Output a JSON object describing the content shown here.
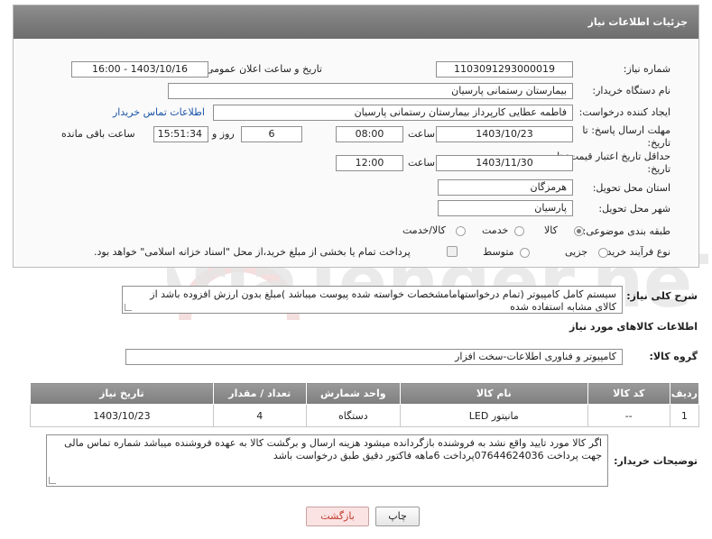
{
  "header": {
    "title": "جزئیات اطلاعات نیاز"
  },
  "form": {
    "need_number_label": "شماره نیاز:",
    "need_number": "1103091293000019",
    "announce_label": "تاریخ و ساعت اعلان عمومی:",
    "announce_value": "1403/10/16 - 16:00",
    "buyer_org_label": "نام دستگاه خریدار:",
    "buyer_org": "بیمارستان رستمانی پارسیان",
    "creator_label": "ایجاد کننده درخواست:",
    "creator": "فاطمه عطایی کارپرداز بیمارستان رستمانی پارسیان",
    "contact_link": "اطلاعات تماس خریدار",
    "deadline_label_1": "مهلت ارسال پاسخ: تا",
    "deadline_label_2": "تاریخ:",
    "deadline_date": "1403/10/23",
    "time_label": "ساعت",
    "deadline_time": "08:00",
    "days_value": "6",
    "days_label": "روز و",
    "remaining_time": "15:51:34",
    "remaining_label": "ساعت باقی مانده",
    "validity_label_1": "حداقل تاریخ اعتبار قیمت: تا",
    "validity_label_2": "تاریخ:",
    "validity_date": "1403/11/30",
    "validity_time_label": "ساعت",
    "validity_time": "12:00",
    "province_label": "استان محل تحویل:",
    "province": "هرمزگان",
    "city_label": "شهر محل تحویل:",
    "city": "پارسیان",
    "category_label": "طبقه بندی موضوعی:",
    "category_options": [
      "کالا",
      "خدمت",
      "کالا/خدمت"
    ],
    "process_label": "نوع فرآیند خرید :",
    "process_options": [
      "جزیی",
      "متوسط"
    ],
    "payment_note": "پرداخت تمام یا بخشی از مبلغ خرید،از محل \"اسناد خزانه اسلامی\" خواهد بود."
  },
  "description": {
    "label": "شرح کلی نیاز:",
    "text": "سیستم کامل کامپیوتر (تمام درخواستهامامشخصات خواسته شده پیوست میباشد )مبلغ بدون ارزش افزوده باشد از کالای مشابه استفاده شده"
  },
  "goods_section": {
    "title": "اطلاعات کالاهای مورد نیاز",
    "group_label": "گروه کالا:",
    "group_value": "کامپیوتر و فناوری اطلاعات-سخت افزار"
  },
  "table": {
    "headers": [
      "ردیف",
      "کد کالا",
      "نام کالا",
      "واحد شمارش",
      "تعداد / مقدار",
      "تاریخ نیاز"
    ],
    "rows": [
      [
        "1",
        "--",
        "مانیتور LED",
        "دستگاه",
        "4",
        "1403/10/23"
      ]
    ]
  },
  "buyer_notes": {
    "label": "توضیحات خریدار:",
    "text": "اگر کالا مورد تایید واقع نشد به فروشنده بازگردانده میشود هزینه ارسال و برگشت کالا به عهده فروشنده میباشد شماره تماس مالی جهت پرداخت 07644624036پرداخت 6ماهه فاکتور دقیق طبق درخواست باشد"
  },
  "buttons": {
    "print": "چاپ",
    "back": "بازگشت"
  },
  "watermark": {
    "text": "AriaTender.neT"
  },
  "colors": {
    "header_bg": "#7d7d7d",
    "link": "#1a54a8",
    "back_btn_text": "#c0392b",
    "back_btn_bg": "#fbe3e3"
  }
}
